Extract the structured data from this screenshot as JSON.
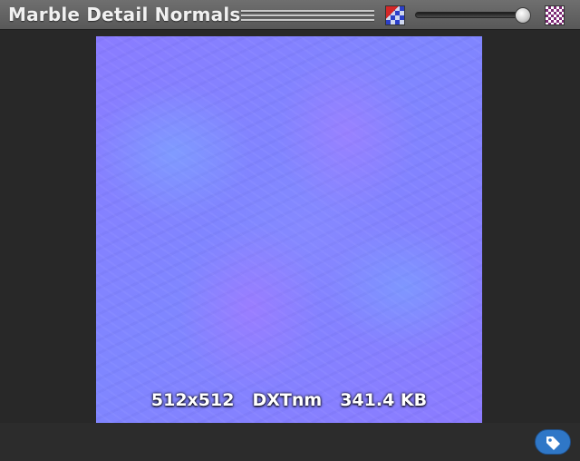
{
  "header": {
    "title": "Marble Detail Normals",
    "rgb_icon": "rgb-channel-icon",
    "alpha_icon": "alpha-checker-icon"
  },
  "preview": {
    "resolution": "512x512",
    "format": "DXTnm",
    "size": "341.4 KB"
  },
  "slider": {
    "mip_level": 1.0
  },
  "footer": {
    "tag_icon": "tag-icon",
    "accent": "#2f77c7"
  }
}
